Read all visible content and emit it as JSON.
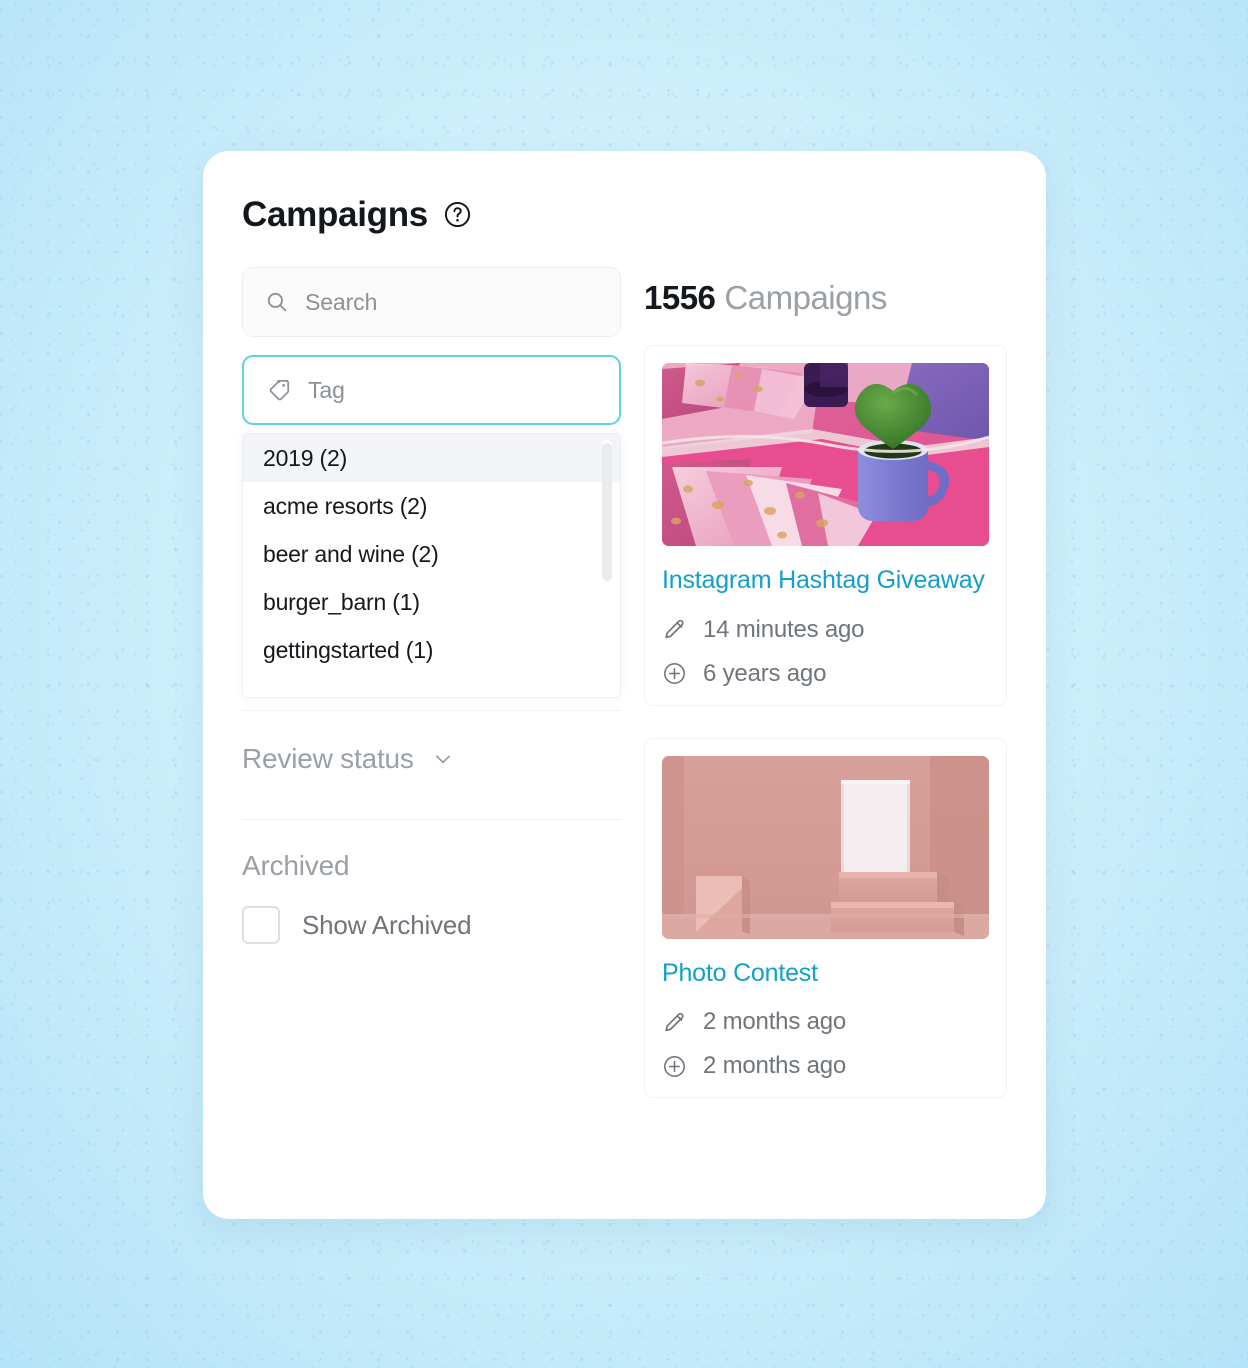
{
  "header": {
    "title": "Campaigns",
    "help_icon": "question-circle-icon"
  },
  "filters": {
    "search": {
      "icon": "search-icon",
      "placeholder": "Search",
      "value": ""
    },
    "tag": {
      "icon": "tag-icon",
      "placeholder": "Tag",
      "value": "",
      "focus_color": "#62cfe9"
    },
    "tag_options": [
      {
        "label": "2019 (2)",
        "active": true
      },
      {
        "label": "acme resorts (2)",
        "active": false
      },
      {
        "label": "beer and wine (2)",
        "active": false
      },
      {
        "label": "burger_barn (1)",
        "active": false
      },
      {
        "label": "gettingstarted (1)",
        "active": false
      }
    ],
    "review_status": {
      "label": "Review status",
      "icon": "chevron-down-icon",
      "expanded": false
    },
    "archived": {
      "label": "Archived",
      "checkbox_label": "Show Archived",
      "checked": false
    }
  },
  "results": {
    "count": "1556",
    "count_label": "Campaigns",
    "cards": [
      {
        "title": "Instagram Hashtag Giveaway",
        "thumbnail_alt": "pink paper fans with purple mug and green heart plant",
        "edited_icon": "pencil-icon",
        "edited": "14 minutes ago",
        "created_icon": "plus-circle-icon",
        "created": "6 years ago"
      },
      {
        "title": "Photo Contest",
        "thumbnail_alt": "dusty pink room with white framed poster on steps",
        "edited_icon": "pencil-icon",
        "edited": "2 months ago",
        "created_icon": "plus-circle-icon",
        "created": "2 months ago"
      }
    ]
  },
  "colors": {
    "link": "#12a0c8",
    "accent": "#62cfe9",
    "background": "#d2f0fb",
    "panel": "#ffffff",
    "muted_text": "#9aa0a6"
  }
}
